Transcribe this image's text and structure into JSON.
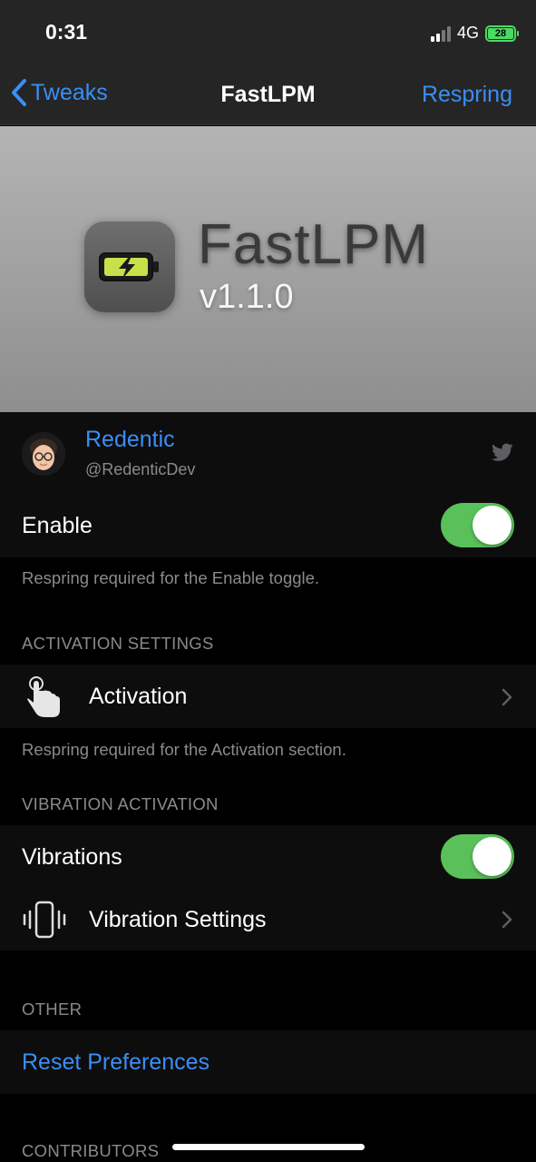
{
  "status_bar": {
    "time": "0:31",
    "network": "4G",
    "battery": "28"
  },
  "navbar": {
    "back_label": "Tweaks",
    "title": "FastLPM",
    "respring_label": "Respring"
  },
  "banner": {
    "title": "FastLPM",
    "version": "v1.1.0"
  },
  "developer": {
    "name": "Redentic",
    "handle": "@RedenticDev"
  },
  "enable": {
    "label": "Enable",
    "on": true,
    "footnote": "Respring required for the Enable toggle."
  },
  "activation_section": {
    "header": "ACTIVATION SETTINGS",
    "item_label": "Activation",
    "footnote": "Respring required for the Activation section."
  },
  "vibration_section": {
    "header": "VIBRATION ACTIVATION",
    "toggle_label": "Vibrations",
    "toggle_on": true,
    "settings_label": "Vibration Settings"
  },
  "other_section": {
    "header": "OTHER",
    "reset_label": "Reset Preferences"
  },
  "contributors_section": {
    "header": "CONTRIBUTORS"
  },
  "colors": {
    "accent": "#3a8ef6",
    "toggle_on": "#5ac05a",
    "battery": "#4cd964"
  }
}
